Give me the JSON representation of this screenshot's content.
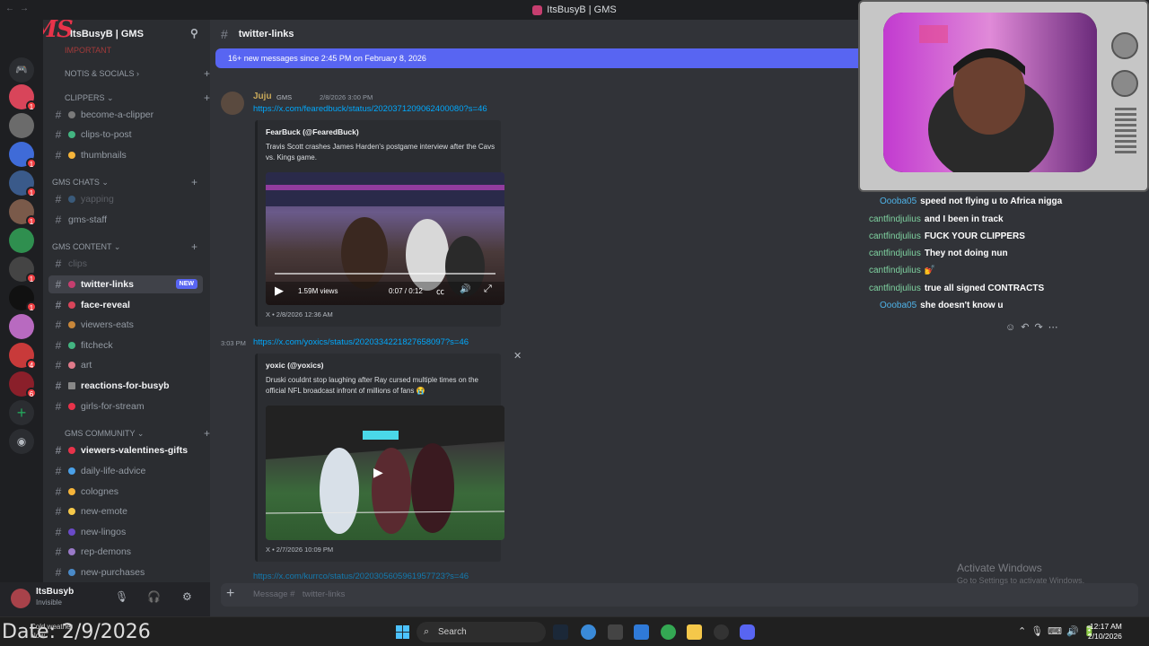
{
  "window": {
    "title": "ItsBusyB | GMS"
  },
  "server": {
    "name": "ItsBusyB | GMS",
    "logo_text": "GMS"
  },
  "sidebar": {
    "partial_top": "IMPORTANT",
    "categories": [
      {
        "label": "NOTIS & SOCIALS"
      },
      {
        "label": "CLIPPERS"
      },
      {
        "label": "GMS CHATS"
      },
      {
        "label": "GMS CONTENT"
      },
      {
        "label": "GMS COMMUNITY"
      }
    ],
    "channels": [
      {
        "label": "become-a-clipper"
      },
      {
        "label": "clips-to-post"
      },
      {
        "label": "thumbnails"
      },
      {
        "label": "yapping"
      },
      {
        "label": "gms-staff"
      },
      {
        "label": "clips"
      },
      {
        "label": "twitter-links",
        "tag": "NEW"
      },
      {
        "label": "face-reveal"
      },
      {
        "label": "viewers-eats"
      },
      {
        "label": "fitcheck"
      },
      {
        "label": "art"
      },
      {
        "label": "reactions-for-busyb"
      },
      {
        "label": "girls-for-stream"
      },
      {
        "label": "viewers-valentines-gifts"
      },
      {
        "label": "daily-life-advice"
      },
      {
        "label": "colognes"
      },
      {
        "label": "new-emote"
      },
      {
        "label": "new-lingos"
      },
      {
        "label": "rep-demons"
      },
      {
        "label": "new-purchases"
      }
    ]
  },
  "user": {
    "name": "ItsBusyb",
    "status": "Invisible"
  },
  "main": {
    "channel": "twitter-links",
    "new_messages_bar": "16+ new messages since 2:45 PM on February 8, 2026",
    "composer_placeholder": "Message #    twitter-links",
    "messages": [
      {
        "author": "Juju",
        "author_tag": "GMS",
        "timestamp": "2/8/2026 3:00 PM",
        "link": "https://x.com/fearedbuck/status/2020371209062400080?s=46",
        "embed": {
          "author": "FearBuck (@FearedBuck)",
          "description": "Travis Scott crashes James Harden's postgame interview after the Cavs vs. Kings game.",
          "views": "1.59M views",
          "time": "0:07 / 0:12",
          "footer": "X • 2/8/2026 12:36 AM"
        }
      },
      {
        "timestamp": "3:03 PM",
        "link": "https://x.com/yoxics/status/2020334221827658097?s=46",
        "embed": {
          "author": "yoxic (@yoxics)",
          "description": "Druski couldnt stop laughing after Ray cursed multiple times on the official NFL broadcast infront of millions of fans 😭",
          "footer": "X • 2/7/2026 10:09 PM"
        }
      }
    ],
    "partial_link": "https://x.com/kurrco/status/2020305605961957723?s=46"
  },
  "stream_chat": [
    {
      "user": "Oooba05",
      "text": "speed not flying u to Africa nigga"
    },
    {
      "user": "cantfindjulius",
      "text": "and I been in track"
    },
    {
      "user": "cantfindjulius",
      "text": "FUCK YOUR CLIPPERS"
    },
    {
      "user": "cantfindjulius",
      "text": "They not doing nun"
    },
    {
      "user": "cantfindjulius",
      "text": "💅"
    },
    {
      "user": "cantfindjulius",
      "text": "true all signed CONTRACTS"
    },
    {
      "user": "Oooba05",
      "text": "she doesn't know u"
    }
  ],
  "activation": {
    "title": "Activate Windows",
    "subtitle": "Go to Settings to activate Windows."
  },
  "taskbar": {
    "weather": "Cold weather",
    "weather2": "Now",
    "date_overlay": "Date: 2/9/2026",
    "search": "Search",
    "time": "12:17 AM",
    "date": "2/10/2026"
  },
  "colors": {
    "accent": "#5865f2",
    "link": "#00a8fc",
    "bg": "#313338",
    "sidebar": "#2b2d31"
  }
}
